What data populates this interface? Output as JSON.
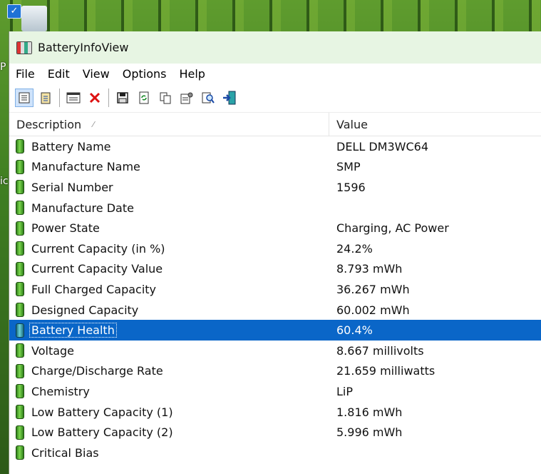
{
  "window": {
    "title": "BatteryInfoView"
  },
  "desktop": {
    "side_letters": [
      "P",
      "ic"
    ]
  },
  "menu": [
    "File",
    "Edit",
    "View",
    "Options",
    "Help"
  ],
  "toolbar": {
    "icons": [
      "view-mode-icon",
      "clipboard-icon",
      "report-window-icon",
      "delete-icon",
      "save-icon",
      "refresh-icon",
      "copy-icon",
      "properties-icon",
      "find-icon",
      "exit-icon"
    ]
  },
  "columns": {
    "description": "Description",
    "value": "Value"
  },
  "rows": [
    {
      "label": "Battery Name",
      "value": "DELL DM3WC64"
    },
    {
      "label": "Manufacture Name",
      "value": "SMP"
    },
    {
      "label": "Serial Number",
      "value": "1596"
    },
    {
      "label": "Manufacture Date",
      "value": ""
    },
    {
      "label": "Power State",
      "value": "Charging, AC Power"
    },
    {
      "label": "Current Capacity (in %)",
      "value": "24.2%"
    },
    {
      "label": "Current Capacity Value",
      "value": "8.793 mWh"
    },
    {
      "label": "Full Charged Capacity",
      "value": "36.267 mWh"
    },
    {
      "label": "Designed Capacity",
      "value": "60.002 mWh"
    },
    {
      "label": "Battery Health",
      "value": "60.4%",
      "selected": true
    },
    {
      "label": "Voltage",
      "value": "8.667 millivolts"
    },
    {
      "label": "Charge/Discharge Rate",
      "value": "21.659 milliwatts"
    },
    {
      "label": "Chemistry",
      "value": "LiP"
    },
    {
      "label": "Low Battery Capacity (1)",
      "value": "1.816 mWh"
    },
    {
      "label": "Low Battery Capacity (2)",
      "value": "5.996 mWh"
    },
    {
      "label": "Critical Bias",
      "value": ""
    }
  ],
  "colors": {
    "selection": "#0a66c8",
    "titlebar": "#e7f5e3"
  }
}
